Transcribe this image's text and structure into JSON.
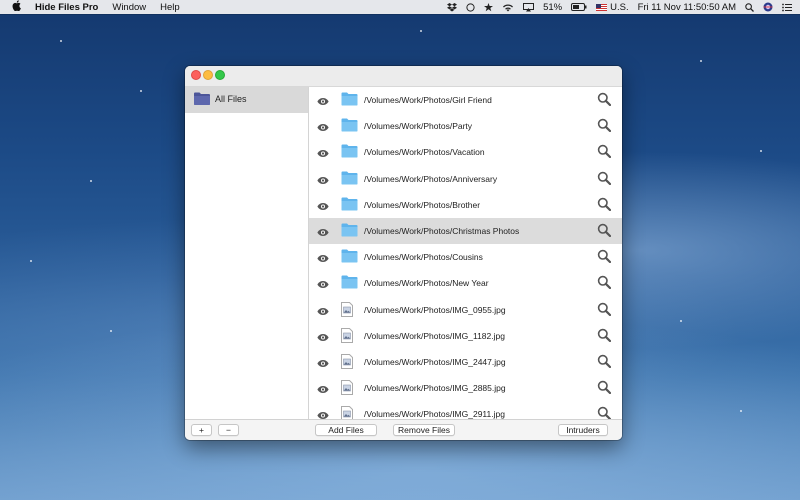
{
  "menubar": {
    "app_name": "Hide Files Pro",
    "menus": [
      "Window",
      "Help"
    ],
    "battery": "51%",
    "input_source": "U.S.",
    "clock": "Fri 11 Nov  11:50:50 AM"
  },
  "sidebar": {
    "items": [
      {
        "label": "All Files",
        "icon": "folder-icon"
      }
    ]
  },
  "files": [
    {
      "path": "/Volumes/Work/Photos/Girl Friend",
      "kind": "folder"
    },
    {
      "path": "/Volumes/Work/Photos/Party",
      "kind": "folder"
    },
    {
      "path": "/Volumes/Work/Photos/Vacation",
      "kind": "folder"
    },
    {
      "path": "/Volumes/Work/Photos/Anniversary",
      "kind": "folder"
    },
    {
      "path": "/Volumes/Work/Photos/Brother",
      "kind": "folder"
    },
    {
      "path": "/Volumes/Work/Photos/Christmas Photos",
      "kind": "folder",
      "selected": true
    },
    {
      "path": "/Volumes/Work/Photos/Cousins",
      "kind": "folder"
    },
    {
      "path": "/Volumes/Work/Photos/New Year",
      "kind": "folder"
    },
    {
      "path": "/Volumes/Work/Photos/IMG_0955.jpg",
      "kind": "image"
    },
    {
      "path": "/Volumes/Work/Photos/IMG_1182.jpg",
      "kind": "image"
    },
    {
      "path": "/Volumes/Work/Photos/IMG_2447.jpg",
      "kind": "image"
    },
    {
      "path": "/Volumes/Work/Photos/IMG_2885.jpg",
      "kind": "image"
    },
    {
      "path": "/Volumes/Work/Photos/IMG_2911.jpg",
      "kind": "image"
    }
  ],
  "toolbar": {
    "add_label": "+",
    "remove_label": "−",
    "add_files_label": "Add Files",
    "remove_files_label": "Remove Files",
    "intruders_label": "Intruders"
  },
  "colors": {
    "folder": "#5fb4ec",
    "sidebar_folder": "#5560a8",
    "selection": "#dcdcdc"
  }
}
